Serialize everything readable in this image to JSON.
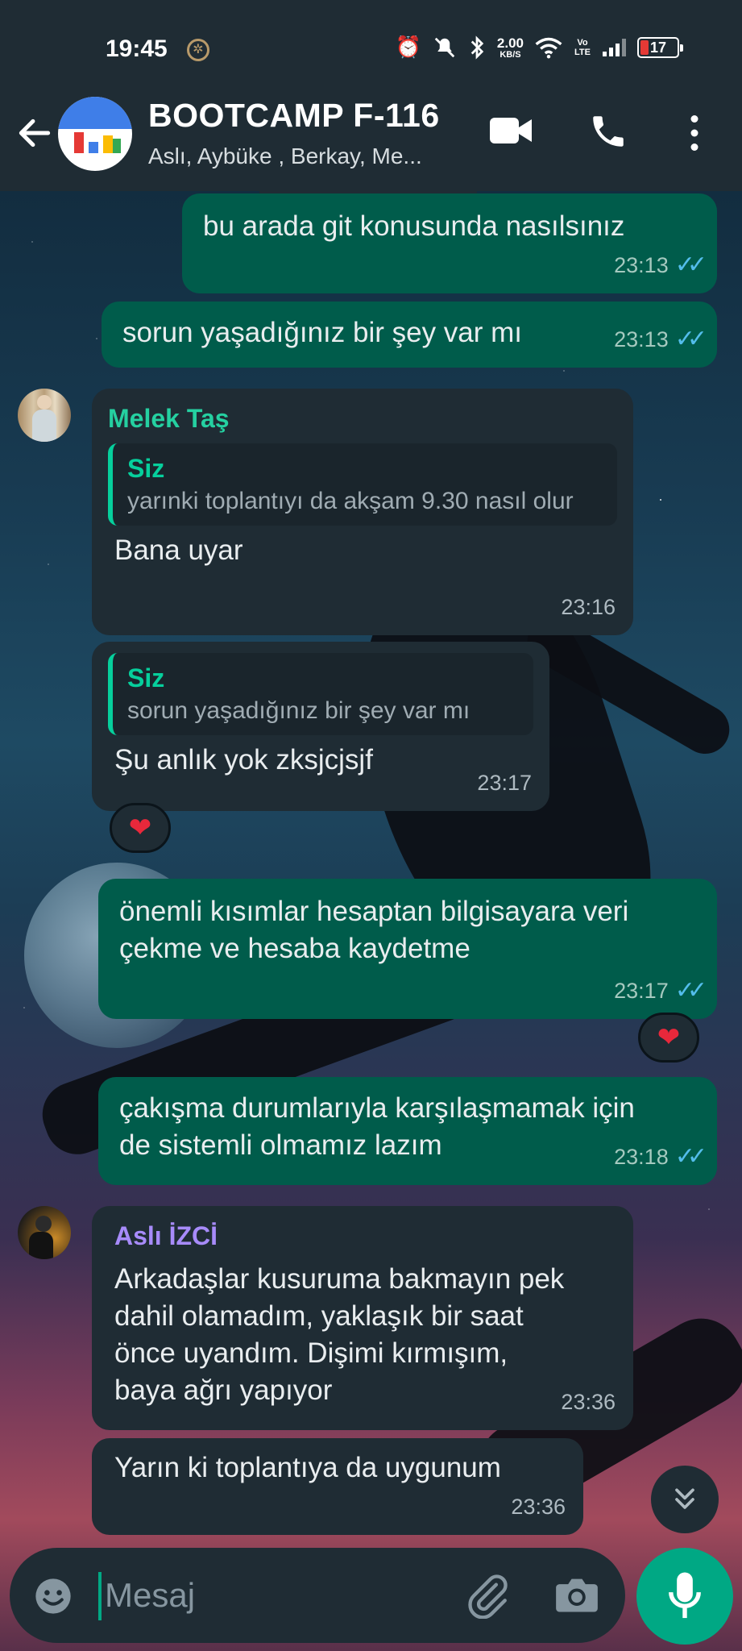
{
  "status_bar": {
    "time": "19:45",
    "net_speed_value": "2.00",
    "net_speed_unit": "KB/S",
    "volte": "Vo LTE",
    "battery": "17"
  },
  "header": {
    "title": "BOOTCAMP F-116",
    "subtitle": "Aslı, Aybüke , Berkay, Me..."
  },
  "messages": [
    {
      "direction": "out",
      "text": "bu arada git konusunda nasılsınız",
      "time": "23:13",
      "ticks": "✓✓"
    },
    {
      "direction": "out",
      "text": "sorun yaşadığınız bir şey var mı",
      "time": "23:13",
      "ticks": "✓✓"
    },
    {
      "direction": "in",
      "sender": "Melek Taş",
      "sender_color": "#25d0a1",
      "quote_author": "Siz",
      "quote_text": "yarınki toplantıyı da akşam 9.30 nasıl olur",
      "text": "Bana uyar",
      "time": "23:16"
    },
    {
      "direction": "in",
      "quote_author": "Siz",
      "quote_text": "sorun yaşadığınız bir şey var mı",
      "text": "Şu anlık yok zksjcjsjf",
      "time": "23:17",
      "reaction": "❤"
    },
    {
      "direction": "out",
      "text": "önemli kısımlar hesaptan bilgisayara veri çekme ve hesaba kaydetme",
      "time": "23:17",
      "ticks": "✓✓",
      "reaction": "❤"
    },
    {
      "direction": "out",
      "text": "çakışma durumlarıyla karşılaşmamak için de sistemli olmamız lazım",
      "time": "23:18",
      "ticks": "✓✓"
    },
    {
      "direction": "in",
      "sender": "Aslı İZCİ",
      "sender_color": "#a78bfa",
      "text": "Arkadaşlar kusuruma bakmayın pek dahil olamadım, yaklaşık bir saat önce uyandım. Dişimi kırmışım, baya ağrı yapıyor",
      "time": "23:36"
    },
    {
      "direction": "in",
      "text": "Yarın ki toplantıya da uygunum",
      "time": "23:36"
    }
  ],
  "composer": {
    "placeholder": "Mesaj"
  },
  "icons": {
    "back": "back-arrow-icon",
    "video": "video-call-icon",
    "call": "phone-icon",
    "more": "more-vert-icon",
    "emoji": "emoji-icon",
    "attach": "paperclip-icon",
    "camera": "camera-icon",
    "mic": "mic-icon",
    "scroll": "double-chevron-down-icon"
  },
  "colors": {
    "outgoing_bubble": "#005c4b",
    "incoming_bubble": "#1f2c34",
    "accent": "#00a884",
    "read_ticks": "#53bdeb"
  }
}
